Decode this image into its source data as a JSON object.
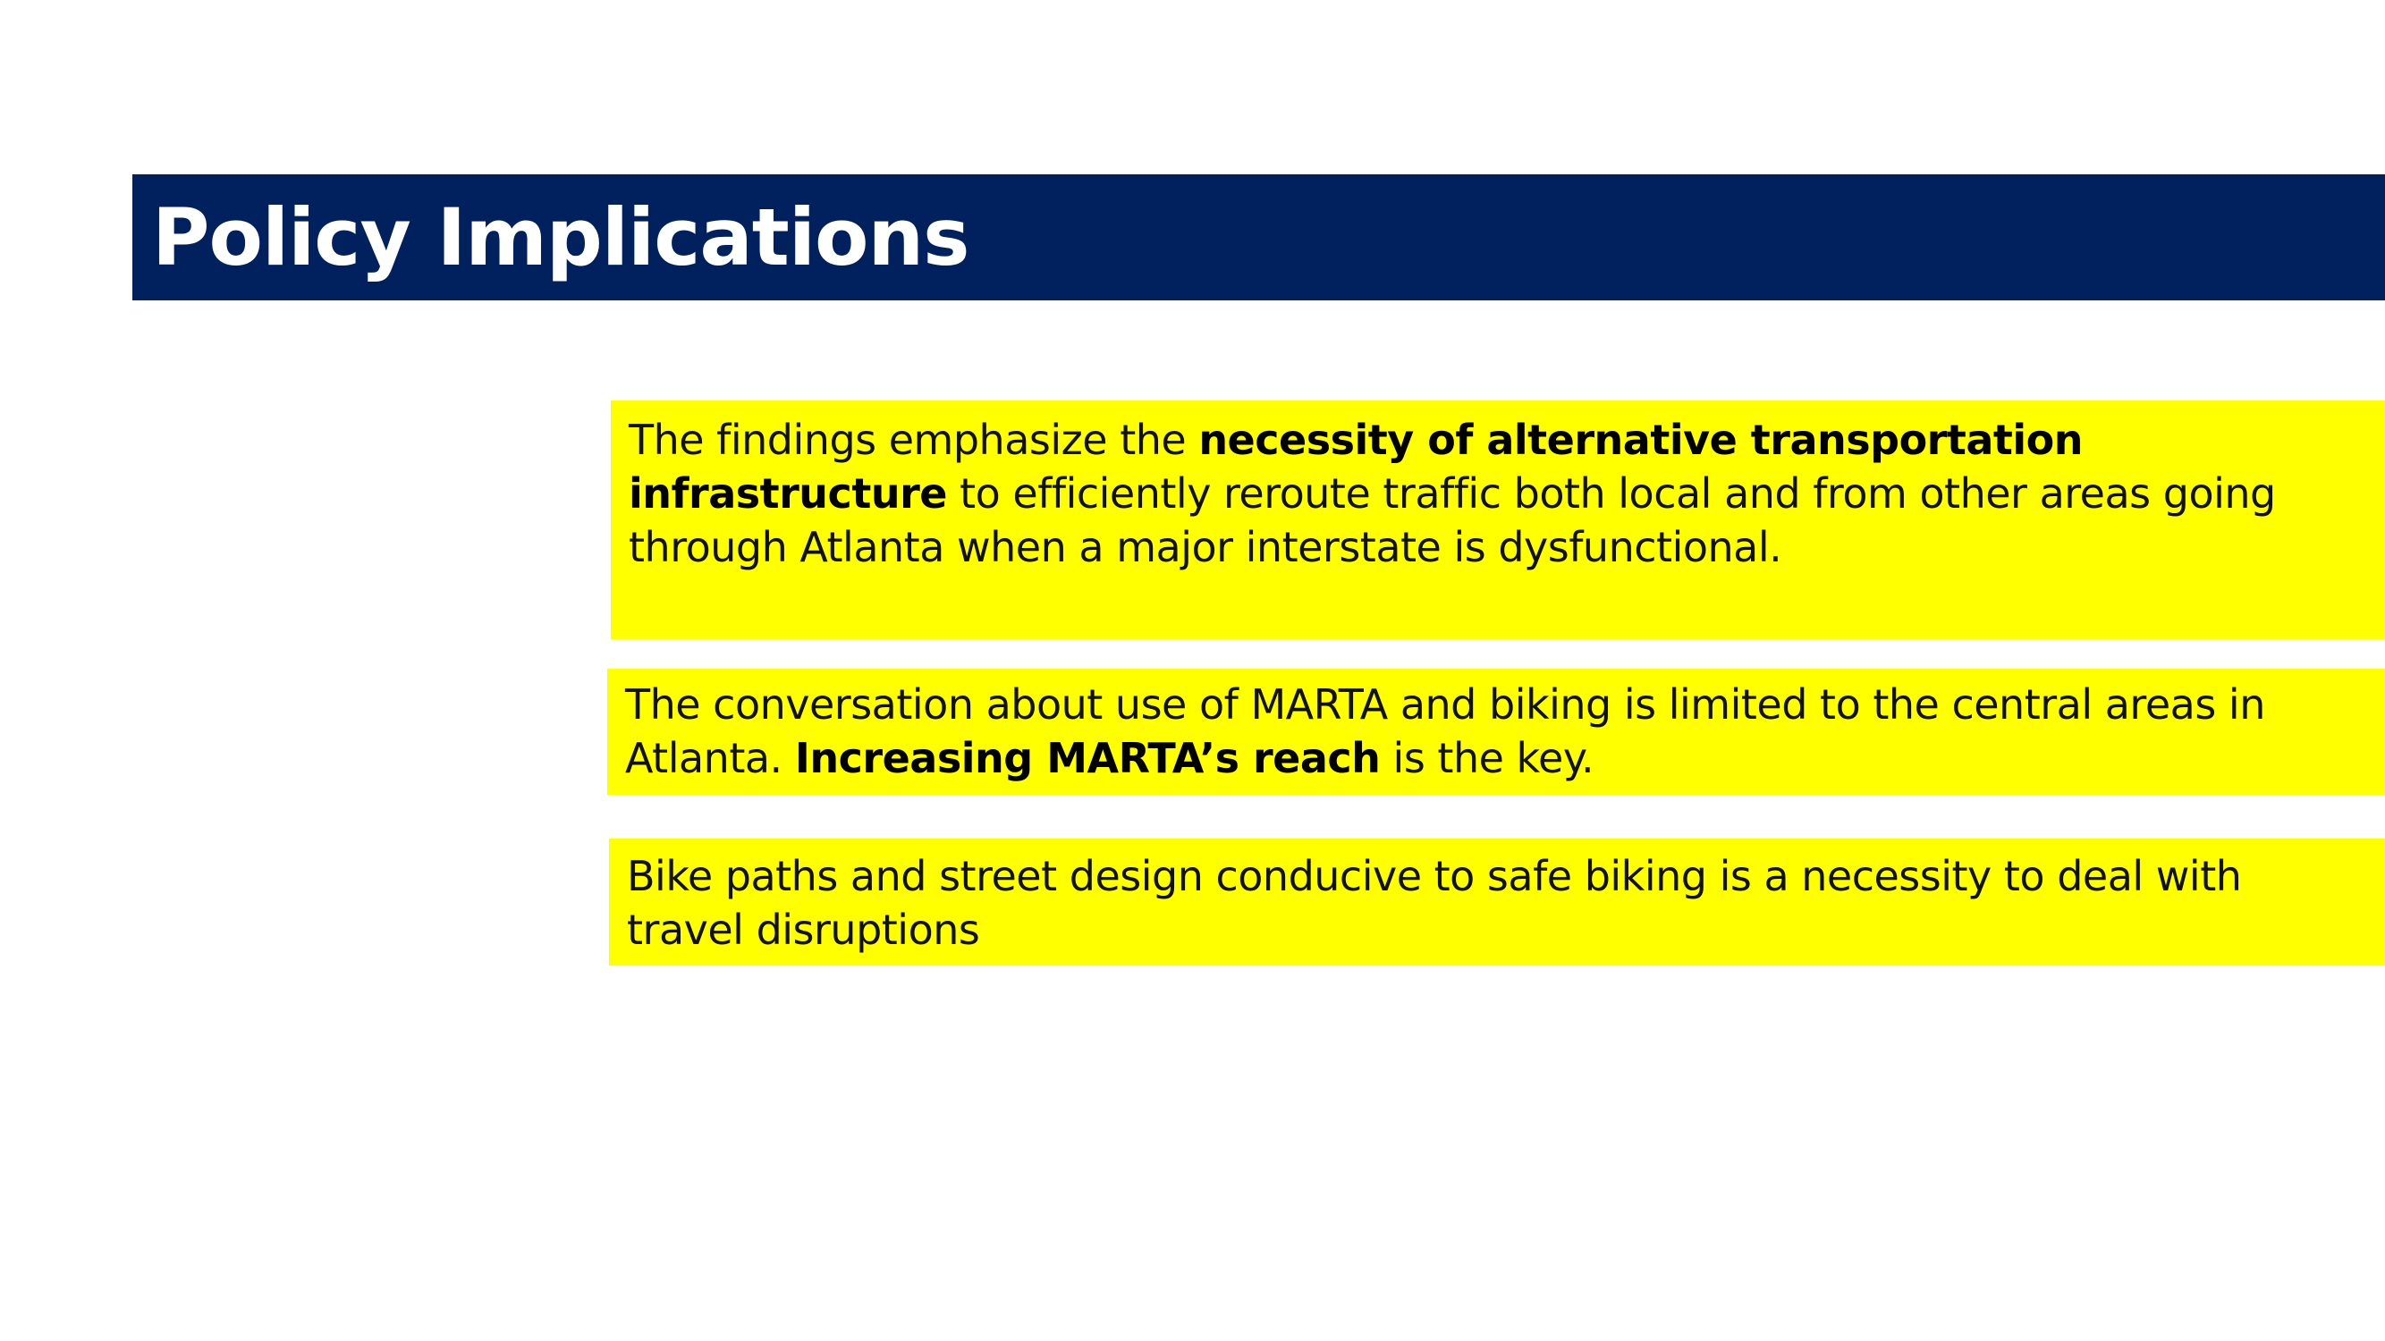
{
  "slide": {
    "title": "Policy Implications",
    "colors": {
      "title_bar": "#00215e",
      "title_text": "#ffffff",
      "highlight_box": "#ffff00",
      "body_text": "#111111"
    }
  },
  "points": [
    {
      "text_before": "The findings emphasize the ",
      "bold": "necessity of alternative transportation infrastructure",
      "text_after": " to efficiently reroute traffic both local and from other areas going through Atlanta when a major interstate is dysfunctional."
    },
    {
      "text_before": "The conversation about use of MARTA and biking is limited to the central areas in Atlanta.  ",
      "bold": "Increasing MARTA’s reach",
      "text_after": " is the key."
    },
    {
      "text_before": "Bike paths and street design conducive to safe biking is a necessity to deal with travel disruptions",
      "bold": "",
      "text_after": ""
    }
  ]
}
